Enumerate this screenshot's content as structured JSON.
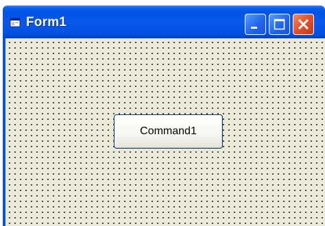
{
  "window": {
    "title": "Form1",
    "icon": "form-icon",
    "controls": {
      "minimize_icon": "minimize-icon",
      "maximize_icon": "maximize-icon",
      "close_icon": "close-icon"
    }
  },
  "form": {
    "command_button_label": "Command1"
  },
  "colors": {
    "title_bar": "#0054e3",
    "client_background": "#ece9d8",
    "close_button": "#e0512c"
  }
}
